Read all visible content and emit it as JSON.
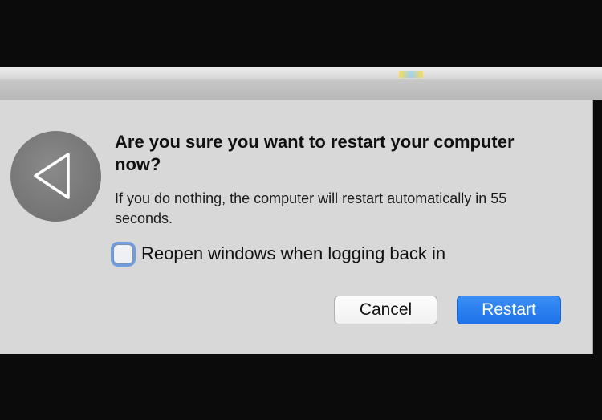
{
  "dialog": {
    "title": "Are you sure you want to restart your computer now?",
    "message": "If you do nothing, the computer will restart automatically in 55 seconds.",
    "icon": "restart-triangle-icon",
    "checkbox": {
      "label": "Reopen windows when logging back in",
      "checked": false
    },
    "buttons": {
      "cancel": "Cancel",
      "restart": "Restart"
    },
    "accent_color": "#1f72e8"
  }
}
